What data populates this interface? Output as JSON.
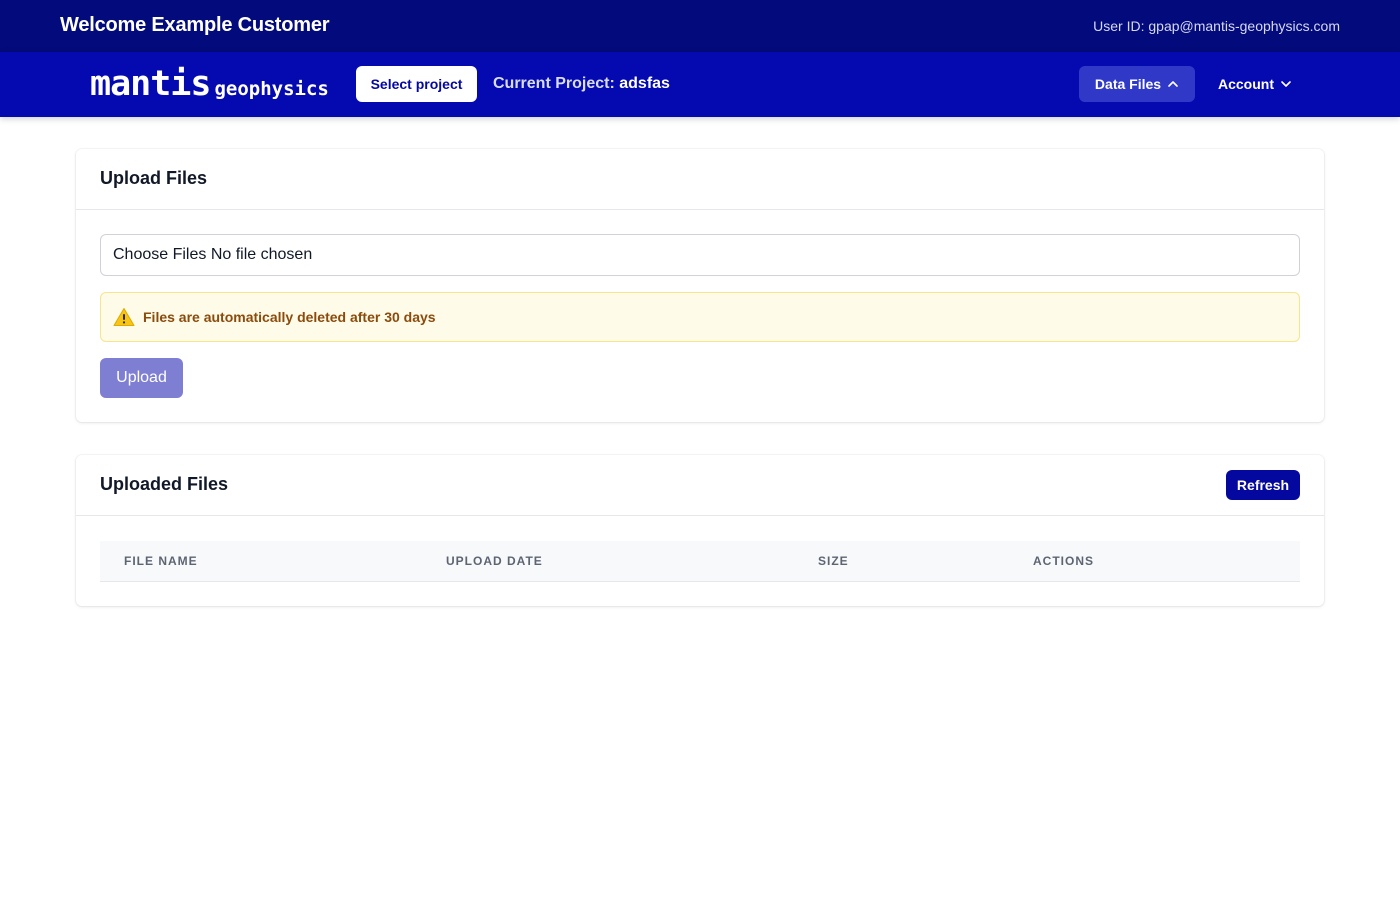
{
  "topbar": {
    "welcome": "Welcome Example Customer",
    "user_id": "User ID: gpap@mantis-geophysics.com"
  },
  "navbar": {
    "logo_main": "mantis",
    "logo_sub": "geophysics",
    "select_project_label": "Select project",
    "current_project_label": "Current Project:",
    "current_project_value": "adsfas",
    "data_files_label": "Data Files",
    "account_label": "Account"
  },
  "upload_card": {
    "title": "Upload Files",
    "file_input_text": "Choose Files No file chosen",
    "warning_text": "Files are automatically deleted after 30 days",
    "upload_label": "Upload"
  },
  "uploaded_card": {
    "title": "Uploaded Files",
    "refresh_label": "Refresh",
    "columns": [
      "FILE NAME",
      "UPLOAD DATE",
      "SIZE",
      "ACTIONS"
    ],
    "rows": []
  },
  "colors": {
    "topbar_bg": "#030a7b",
    "navbar_bg": "#0509b0",
    "accent": "#04089f",
    "warning_bg": "#fefbe8",
    "warning_text": "#8a4b0d"
  },
  "icons": {
    "warning": "warning-triangle-icon",
    "data_files_chevron": "chevron-up-icon",
    "account_chevron": "chevron-down-icon"
  }
}
